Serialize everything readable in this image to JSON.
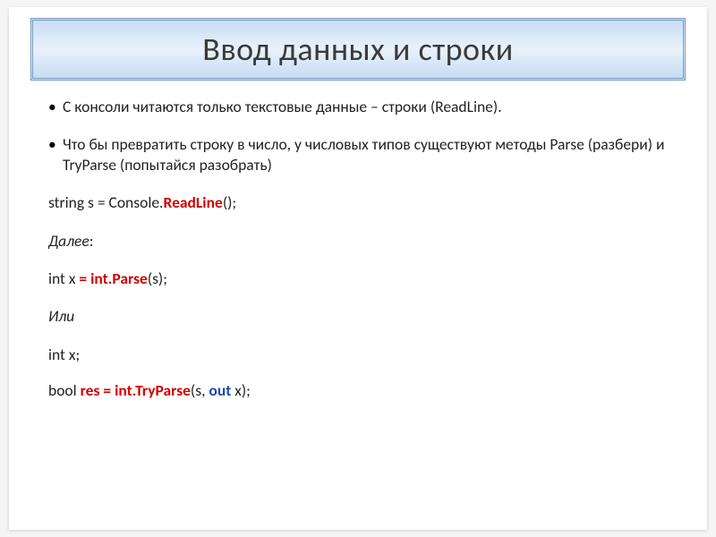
{
  "title": "Ввод данных и строки",
  "bullets": [
    "С консоли читаются только текстовые данные – строки (ReadLine).",
    "Что бы превратить строку в число, у числовых типов существуют методы Parse (разбери) и TryParse (попытайся разобрать)"
  ],
  "line1": {
    "a": "string s = Console.",
    "b": "ReadLine",
    "c": "();"
  },
  "then_label": "Далее",
  "then_colon": ":",
  "line2": {
    "a": "int x ",
    "b": "= int.Parse",
    "c": "(s);"
  },
  "or_label": "Или",
  "line3": "int x;",
  "line4": {
    "a": "bool ",
    "b": "res ",
    "c": "= int.TryParse",
    "d": "(s, ",
    "e": "out ",
    "f": "x);"
  }
}
